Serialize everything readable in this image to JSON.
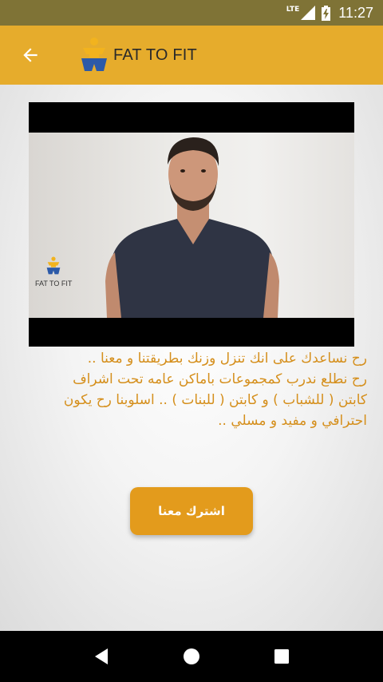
{
  "status_bar": {
    "network": "LTE",
    "time": "11:27"
  },
  "app_bar": {
    "title": "FAT TO FIT",
    "back_icon": "arrow-back-icon",
    "logo_icon": "fat-to-fit-logo"
  },
  "video": {
    "watermark_text": "FAT TO FIT"
  },
  "description": {
    "lines": [
      "رح نساعدك على انك تنزل وزنك بطريقتنا و معنا ..",
      "رح نطلع ندرب كمجموعات باماكن عامه تحت اشراف",
      "كابتن ( للشباب ) و كابتن ( للبنات ) .. اسلوبنا رح يكون",
      "احترافي و مفيد و مسلي .."
    ]
  },
  "subscribe_button": {
    "label": "اشترك معنا"
  },
  "colors": {
    "app_bar": "#e6ac2c",
    "status_bar": "#7f7336",
    "accent_text": "#d58f1c",
    "button": "#e39b1c"
  },
  "nav_bar": {
    "back_icon": "triangle-back-icon",
    "home_icon": "circle-home-icon",
    "recents_icon": "square-recents-icon"
  }
}
